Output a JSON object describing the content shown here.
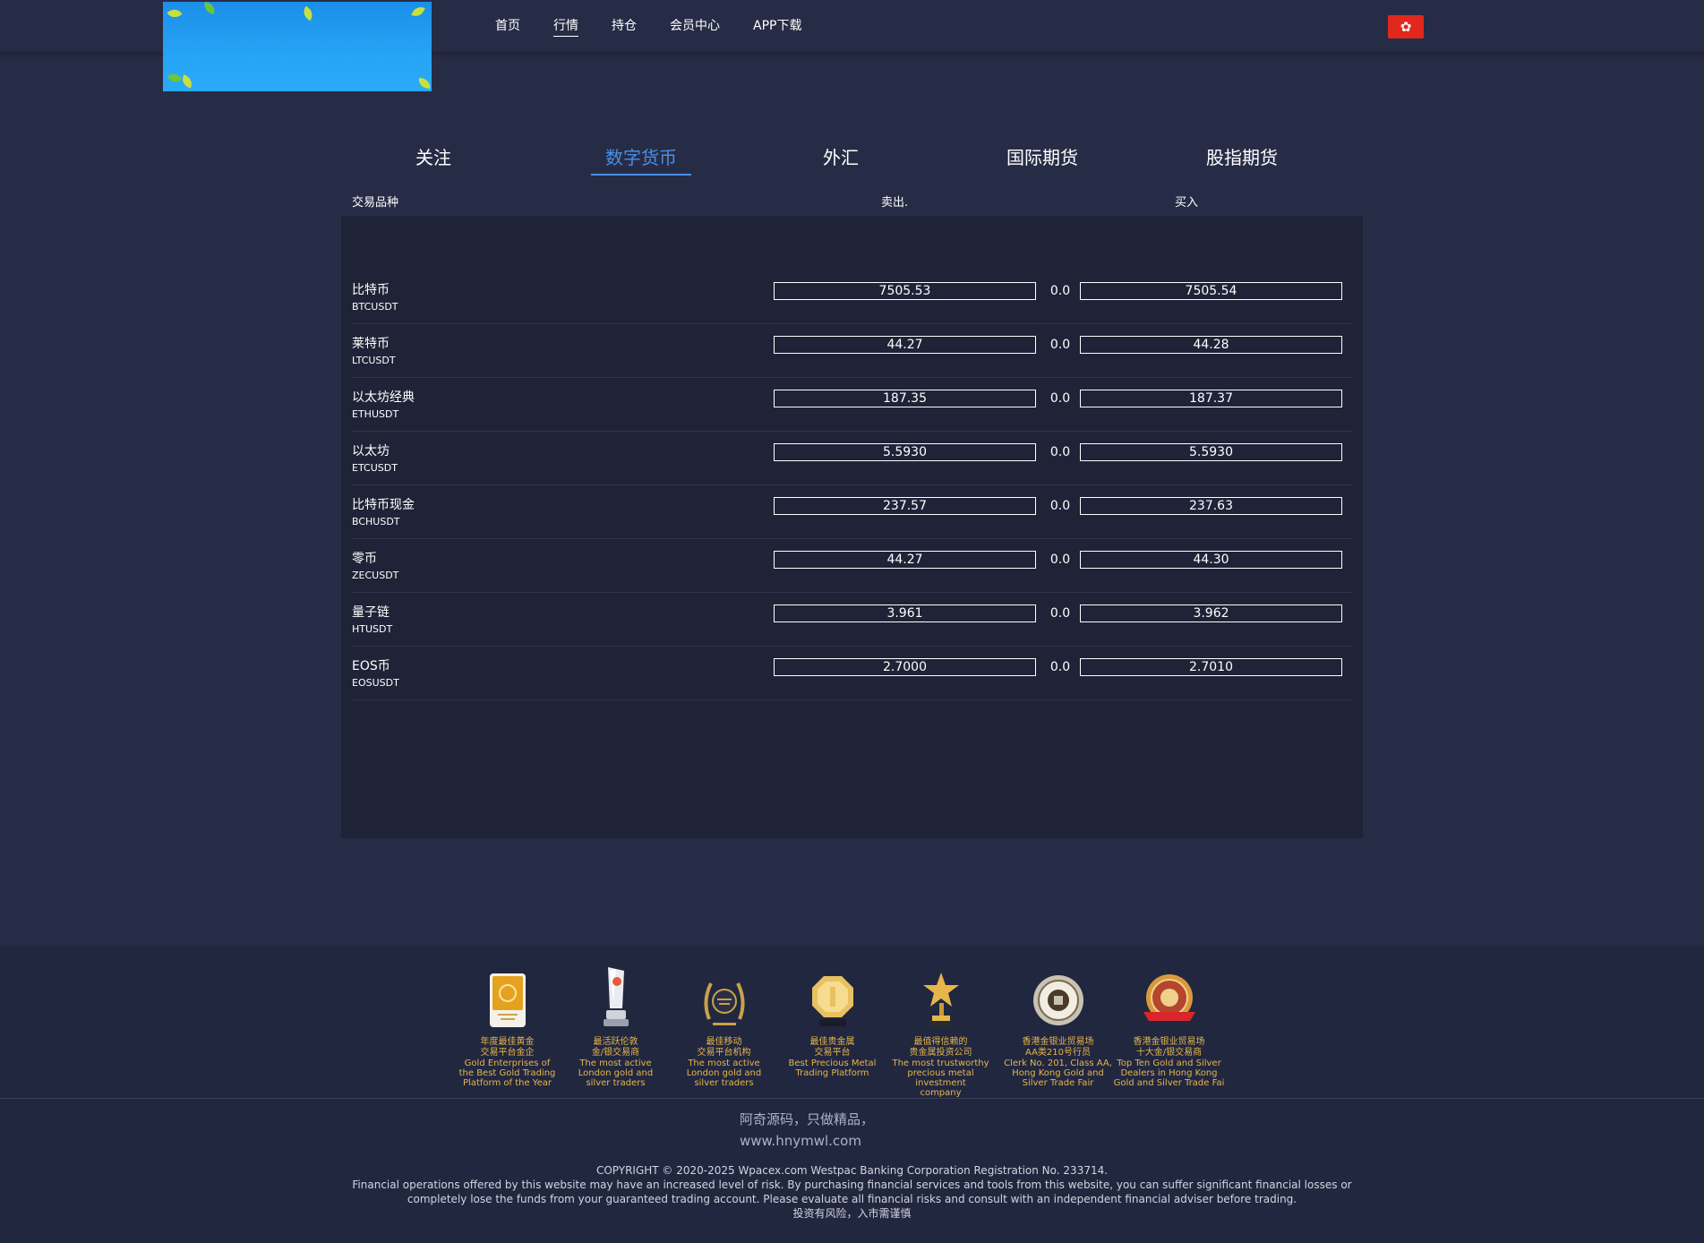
{
  "header": {
    "nav": [
      "首页",
      "行情",
      "持仓",
      "会员中心",
      "APP下载"
    ],
    "active_nav": "行情",
    "flag_icon": "hong-kong-flag-icon"
  },
  "tabs": [
    "关注",
    "数字货币",
    "外汇",
    "国际期货",
    "股指期货"
  ],
  "active_tab": "数字货币",
  "columns": {
    "instrument": "交易品种",
    "sell": "卖出.",
    "buy": "买入"
  },
  "rows": [
    {
      "name": "比特币",
      "code": "BTCUSDT",
      "sell": "7505.53",
      "change": "0.0",
      "buy": "7505.54"
    },
    {
      "name": "莱特币",
      "code": "LTCUSDT",
      "sell": "44.27",
      "change": "0.0",
      "buy": "44.28"
    },
    {
      "name": "以太坊经典",
      "code": "ETHUSDT",
      "sell": "187.35",
      "change": "0.0",
      "buy": "187.37"
    },
    {
      "name": "以太坊",
      "code": "ETCUSDT",
      "sell": "5.5930",
      "change": "0.0",
      "buy": "5.5930"
    },
    {
      "name": "比特币现金",
      "code": "BCHUSDT",
      "sell": "237.57",
      "change": "0.0",
      "buy": "237.63"
    },
    {
      "name": "零币",
      "code": "ZECUSDT",
      "sell": "44.27",
      "change": "0.0",
      "buy": "44.30"
    },
    {
      "name": "量子链",
      "code": "HTUSDT",
      "sell": "3.961",
      "change": "0.0",
      "buy": "3.962"
    },
    {
      "name": "EOS币",
      "code": "EOSUSDT",
      "sell": "2.7000",
      "change": "0.0",
      "buy": "2.7010"
    }
  ],
  "awards": [
    {
      "icon": "gold-plaque-icon",
      "cn": [
        "年度最佳黄金",
        "交易平台金企"
      ],
      "en": [
        "Gold Enterprises of",
        "the Best Gold Trading",
        "Platform of the Year"
      ]
    },
    {
      "icon": "crystal-trophy-icon",
      "cn": [
        "最活跃伦敦",
        "金/银交易商"
      ],
      "en": [
        "The most active",
        "London gold and",
        "silver traders"
      ]
    },
    {
      "icon": "laurel-medal-icon",
      "cn": [
        "最佳移动",
        "交易平台机构"
      ],
      "en": [
        "The most active",
        "London gold and",
        "silver traders"
      ]
    },
    {
      "icon": "gold-octagon-icon",
      "cn": [
        "最佳贵金属",
        "交易平台"
      ],
      "en": [
        "Best Precious Metal",
        "Trading Platform"
      ]
    },
    {
      "icon": "star-trophy-icon",
      "cn": [
        "最值得信赖的",
        "贵金属投资公司"
      ],
      "en": [
        "The most trustworthy",
        "precious metal investment",
        "company"
      ]
    },
    {
      "icon": "seal-badge-icon",
      "cn": [
        "香港金银业贸易场",
        "AA类210号行员"
      ],
      "en": [
        "Clerk No. 201, Class AA,",
        "Hong Kong Gold and",
        "Silver Trade Fair"
      ]
    },
    {
      "icon": "red-ribbon-seal-icon",
      "cn": [
        "香港金银业贸易场",
        "十大金/银交易商"
      ],
      "en": [
        "Top Ten Gold and Silver",
        "Dealers in Hong Kong",
        "Gold and Silver Trade Fai"
      ]
    }
  ],
  "footer": {
    "slogan_1": "阿奇源码，只做精品，",
    "slogan_2": "www.hnymwl.com",
    "copyright": "COPYRIGHT © 2020-2025 Wpacex.com Westpac Banking Corporation Registration No. 233714.",
    "risk_1": "Financial operations offered by this website may have an increased level of risk. By purchasing financial services and tools from this website, you can suffer significant financial losses or",
    "risk_2": "completely lose the funds from your guaranteed trading account. Please evaluate all financial risks and consult with an independent financial adviser before trading.",
    "risk_cn": "投资有风险，入市需谨慎"
  },
  "colors": {
    "background": "#272c46",
    "panel": "#1f2337",
    "accent": "#4a8fe6",
    "award_gold": "#e6b64a",
    "flag_red": "#e0281d"
  }
}
